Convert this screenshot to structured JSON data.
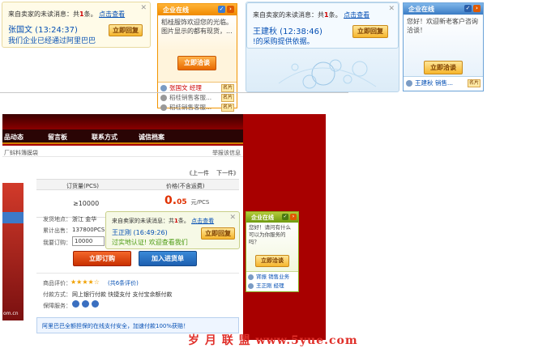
{
  "toast1": {
    "msg_prefix": "来自卖家的未读消息：共",
    "msg_count": "1",
    "msg_unit": "条。",
    "msg_link": "点击查看",
    "sender": "张国文 (13:24:37)",
    "line": "我们企业已经通过阿里巴巴",
    "reply": "立即回复"
  },
  "panel1": {
    "title": "企业在线",
    "text": "稻桂服饰欢迎您的光临。图片显示的都有现货，...",
    "consult": "立即洽谈",
    "contacts": [
      {
        "name": "张国文",
        "role": "经理",
        "tag": "名片"
      },
      {
        "name": "稻桂销售客服...",
        "role": "",
        "tag": "名片"
      },
      {
        "name": "稻桂销售客服...",
        "role": "",
        "tag": "名片"
      }
    ]
  },
  "toast2": {
    "msg_prefix": "来自卖家的未读消息：共",
    "msg_count": "1",
    "msg_unit": "条。",
    "msg_link": "点击查看",
    "sender": "王建秋 (12:38:46)",
    "line": "!的采购提供依据。",
    "reply": "立即回复"
  },
  "panel2": {
    "title": "企业在线",
    "text": "您好！欢迎新老客户咨询洽谈！",
    "consult": "立即洽谈",
    "contacts": [
      {
        "name": "王建秋",
        "role": "销售...",
        "tag": "名片"
      }
    ]
  },
  "site": {
    "nav": [
      "品动态",
      "留言板",
      "联系方式",
      "诚信档案"
    ],
    "crumb": "厂蚪料簿膜袋",
    "report": "举报该信息",
    "prev": "《上一件",
    "next": "下一件》",
    "col_qty": "订货量(PCS)",
    "col_price": "价格(不含运费)",
    "qty": "≥10000",
    "price_big": "0.",
    "price_small": "05",
    "price_unit": "元/PCS",
    "ship_label": "发货地点：",
    "ship_val": "浙江 金华",
    "stock_label": "累计出售：",
    "stock_val": "137800PCS",
    "order_label": "我要订购：",
    "order_val": "10000",
    "order_btn": "立即订购",
    "cart_btn": "加入进货单",
    "rating_label": "商品评价：",
    "rating_val": "(共6条评价)",
    "pay_label": "付款方式：",
    "pay_val": "网上银行付款  快捷支付  支付宝余额付款",
    "protect_label": "保障服务：",
    "notice": "阿里巴巴全额担保的在线支付安全，加速付款100%获赔！",
    "left_watermark": "om.cn"
  },
  "toast3": {
    "msg_prefix": "来自卖家的未读消息：共",
    "msg_count": "1",
    "msg_unit": "条。",
    "msg_link": "点击查看",
    "sender": "王正刚 (16:49:26)",
    "line": "过实地认证! 欢迎查看我们",
    "reply": "立即回复"
  },
  "panel3": {
    "title": "企业在线",
    "text": "您好！请问有什么可以为你服务的吗？",
    "consult": "立即洽谈",
    "contacts": [
      {
        "name": "宵振",
        "role": "销售业务"
      },
      {
        "name": "王正刚",
        "role": "经理"
      }
    ]
  },
  "watermark": "岁 月 联 盟  www.5yue.com",
  "colors": {
    "orange": "#f29400",
    "red": "#b00000",
    "link": "#0650b4"
  }
}
